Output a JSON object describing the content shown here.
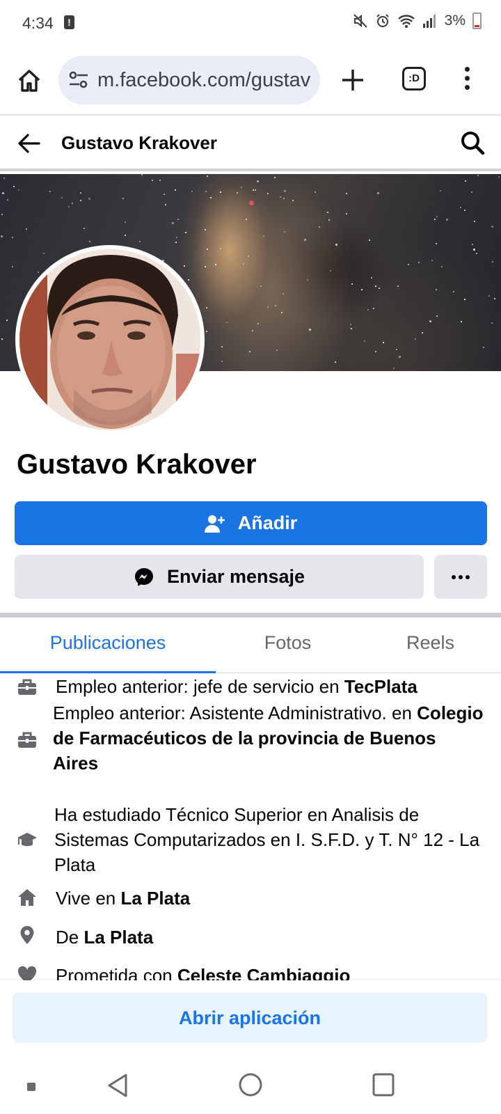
{
  "status_bar": {
    "time": "4:34",
    "battery_text": "3%",
    "icons": [
      "alert-icon",
      "mute-icon",
      "alarm-icon",
      "wifi-icon",
      "signal-icon",
      "battery-icon"
    ]
  },
  "browser": {
    "url": "m.facebook.com/gustav",
    "tab_switcher_label": ":D",
    "icons": [
      "home-icon",
      "site-settings-icon",
      "plus-icon",
      "menu-icon"
    ]
  },
  "header": {
    "title": "Gustavo Krakover",
    "icons": [
      "back-arrow-icon",
      "search-icon"
    ]
  },
  "profile": {
    "name": "Gustavo Krakover",
    "add_label": "Añadir",
    "message_label": "Enviar mensaje",
    "more_label": "more-options"
  },
  "tabs": [
    {
      "label": "Publicaciones",
      "active": true
    },
    {
      "label": "Fotos",
      "active": false
    },
    {
      "label": "Reels",
      "active": false
    }
  ],
  "intro": [
    {
      "icon": "briefcase-icon",
      "prefix": "Empleo anterior: jefe de servicio en ",
      "bold": "TecPlata"
    },
    {
      "icon": "briefcase-icon",
      "prefix": "Empleo anterior: Asistente Administrativo. en ",
      "bold": "Colegio de Farmacéuticos de la provincia de Buenos Aires"
    },
    {
      "icon": "graduation-cap-icon",
      "prefix": "Ha estudiado Técnico Superior en Analisis de Sistemas Computarizados en I. S.F.D. y T. N° 12 - La Plata",
      "bold": ""
    },
    {
      "icon": "home-icon",
      "prefix": "Vive en ",
      "bold": "La Plata"
    },
    {
      "icon": "location-pin-icon",
      "prefix": "De ",
      "bold": "La Plata"
    },
    {
      "icon": "heart-icon",
      "prefix": "Prometida con ",
      "bold": "Celeste Cambiaggio"
    }
  ],
  "open_app": {
    "label": "Abrir aplicación"
  },
  "colors": {
    "facebook_blue": "#1b74e4",
    "secondary_button": "#e4e6eb",
    "open_app_bg": "#e7f3ff"
  }
}
